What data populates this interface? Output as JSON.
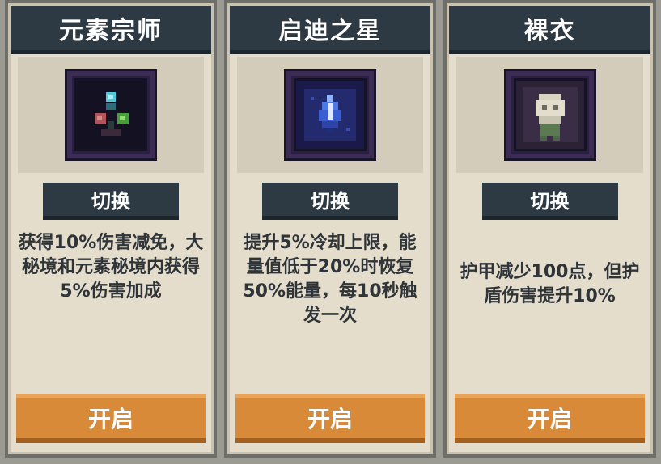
{
  "cards": [
    {
      "title": "元素宗师",
      "icon": "elemental-orbs-icon",
      "switch_label": "切换",
      "description": "获得10%伤害减免，大秘境和元素秘境内获得5%伤害加成",
      "open_label": "开启"
    },
    {
      "title": "启迪之星",
      "icon": "blue-crystal-icon",
      "switch_label": "切换",
      "description": "提升5%冷却上限，能量值低于20%时恢复50%能量，每10秒触发一次",
      "open_label": "开启"
    },
    {
      "title": "裸衣",
      "icon": "bare-character-icon",
      "switch_label": "切换",
      "description": "护甲减少100点，但护盾伤害提升10%",
      "open_label": "开启"
    }
  ],
  "colors": {
    "header_bg": "#2e3a43",
    "card_bg": "#e4ddcc",
    "open_button": "#d98a38",
    "icon_frame": "#3a2c55"
  }
}
